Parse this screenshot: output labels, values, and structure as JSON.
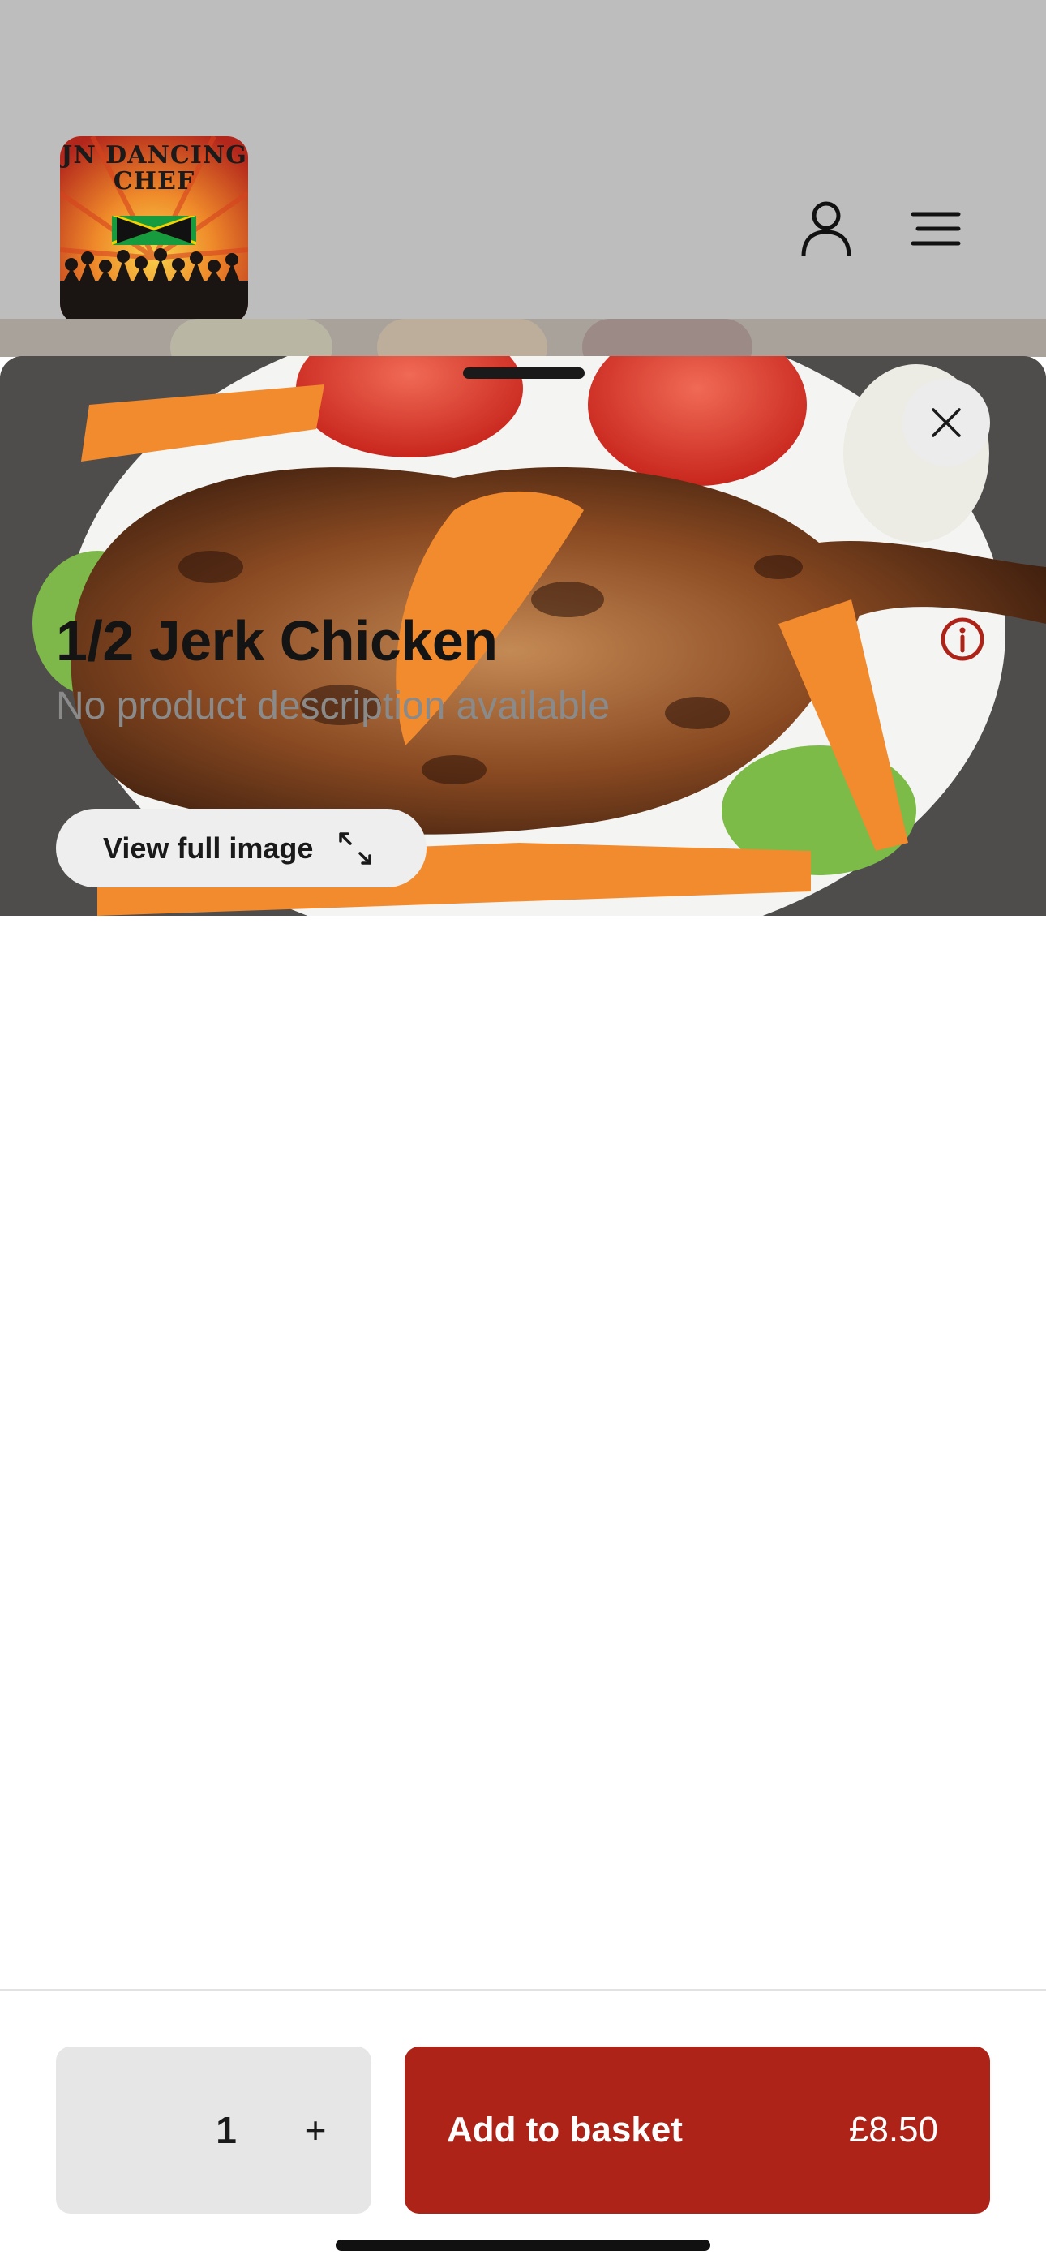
{
  "header": {
    "logo_alt": "JN Dancing Chef logo",
    "logo_line1": "JN DANCING",
    "logo_line2": "CHEF",
    "icons": [
      "user-icon",
      "menu-icon"
    ]
  },
  "product_sheet": {
    "view_full_image_label": "View full image",
    "title": "1/2 Jerk Chicken",
    "description": "No product description available",
    "quantity": "1",
    "plus_label": "+",
    "add_to_basket_label": "Add to basket",
    "price": "£8.50"
  },
  "colors": {
    "accent": "#ad2318",
    "header_overlay": "#bdbdbd",
    "qty_bg": "#e6e6e6"
  }
}
